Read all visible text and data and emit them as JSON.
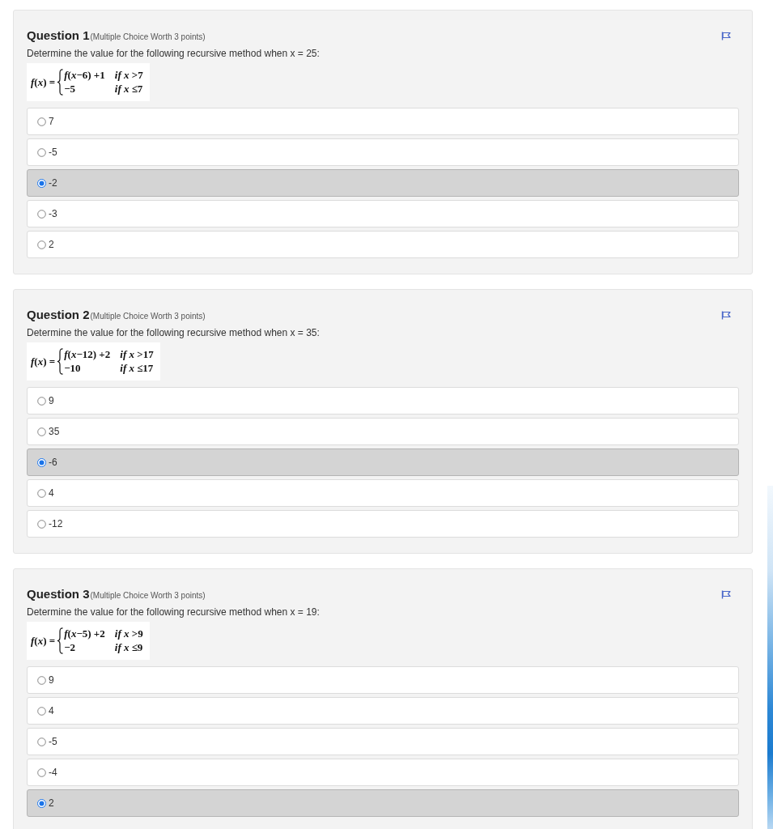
{
  "questions": [
    {
      "title": "Question 1",
      "meta": "(Multiple Choice Worth 3 points)",
      "prompt": "Determine the value for the following recursive method when x = 25:",
      "formula": {
        "lhs": "*f*(*x*) =",
        "cases": [
          {
            "expression": "*f*(*x*−6) +1",
            "condition": "*if x* >7"
          },
          {
            "expression": "−5",
            "condition": "*if x* ≤7"
          }
        ]
      },
      "options": [
        {
          "label": "7",
          "selected": false
        },
        {
          "label": "-5",
          "selected": false
        },
        {
          "label": "-2",
          "selected": true
        },
        {
          "label": "-3",
          "selected": false
        },
        {
          "label": "2",
          "selected": false
        }
      ]
    },
    {
      "title": "Question 2",
      "meta": "(Multiple Choice Worth 3 points)",
      "prompt": "Determine the value for the following recursive method when x = 35:",
      "formula": {
        "lhs": "*f*(*x*) =",
        "cases": [
          {
            "expression": "*f*(*x*−12) +2",
            "condition": "*if x* >17"
          },
          {
            "expression": "−10",
            "condition": "*if x* ≤17"
          }
        ]
      },
      "options": [
        {
          "label": "9",
          "selected": false
        },
        {
          "label": "35",
          "selected": false
        },
        {
          "label": "-6",
          "selected": true
        },
        {
          "label": "4",
          "selected": false
        },
        {
          "label": "-12",
          "selected": false
        }
      ]
    },
    {
      "title": "Question 3",
      "meta": "(Multiple Choice Worth 3 points)",
      "prompt": "Determine the value for the following recursive method when x = 19:",
      "formula": {
        "lhs": "*f*(*x*) =",
        "cases": [
          {
            "expression": "*f*(*x*−5) +2",
            "condition": "*if x* >9"
          },
          {
            "expression": "−2",
            "condition": "*if x* ≤9"
          }
        ]
      },
      "options": [
        {
          "label": "9",
          "selected": false
        },
        {
          "label": "4",
          "selected": false
        },
        {
          "label": "-5",
          "selected": false
        },
        {
          "label": "-4",
          "selected": false
        },
        {
          "label": "2",
          "selected": true
        }
      ]
    }
  ]
}
